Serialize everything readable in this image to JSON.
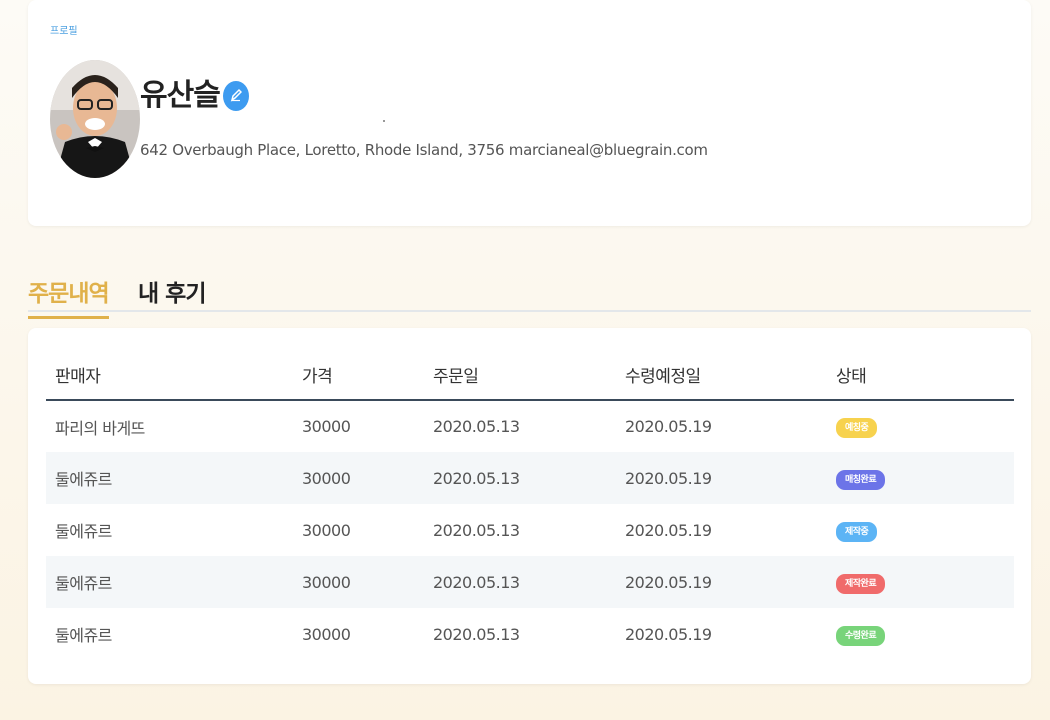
{
  "profile": {
    "label": "프로필",
    "name": "유산슬",
    "address": "642 Overbaugh Place, Loretto, Rhode Island, 3756 marcianeal@bluegrain.com"
  },
  "tabs": [
    {
      "label": "주문내역",
      "active": true
    },
    {
      "label": "내 후기",
      "active": false
    }
  ],
  "table": {
    "headers": [
      "판매자",
      "가격",
      "주문일",
      "수령예정일",
      "상태"
    ],
    "rows": [
      {
        "seller": "파리의 바게뜨",
        "price": "30000",
        "order_date": "2020.05.13",
        "pickup_date": "2020.05.19",
        "status": "예칭중",
        "status_color": "#f7d24e"
      },
      {
        "seller": "둘에쥬르",
        "price": "30000",
        "order_date": "2020.05.13",
        "pickup_date": "2020.05.19",
        "status": "매칭완료",
        "status_color": "#6c74e8"
      },
      {
        "seller": "둘에쥬르",
        "price": "30000",
        "order_date": "2020.05.13",
        "pickup_date": "2020.05.19",
        "status": "제작중",
        "status_color": "#5cb4f5"
      },
      {
        "seller": "둘에쥬르",
        "price": "30000",
        "order_date": "2020.05.13",
        "pickup_date": "2020.05.19",
        "status": "제작완료",
        "status_color": "#f06b6b"
      },
      {
        "seller": "둘에쥬르",
        "price": "30000",
        "order_date": "2020.05.13",
        "pickup_date": "2020.05.19",
        "status": "수령완료",
        "status_color": "#78d47a"
      }
    ]
  },
  "colors": {
    "accent": "#e0b14a",
    "edit_button": "#3d9bf0",
    "profile_label": "#4a9fe0"
  },
  "icons": {
    "edit": "pencil-icon"
  }
}
